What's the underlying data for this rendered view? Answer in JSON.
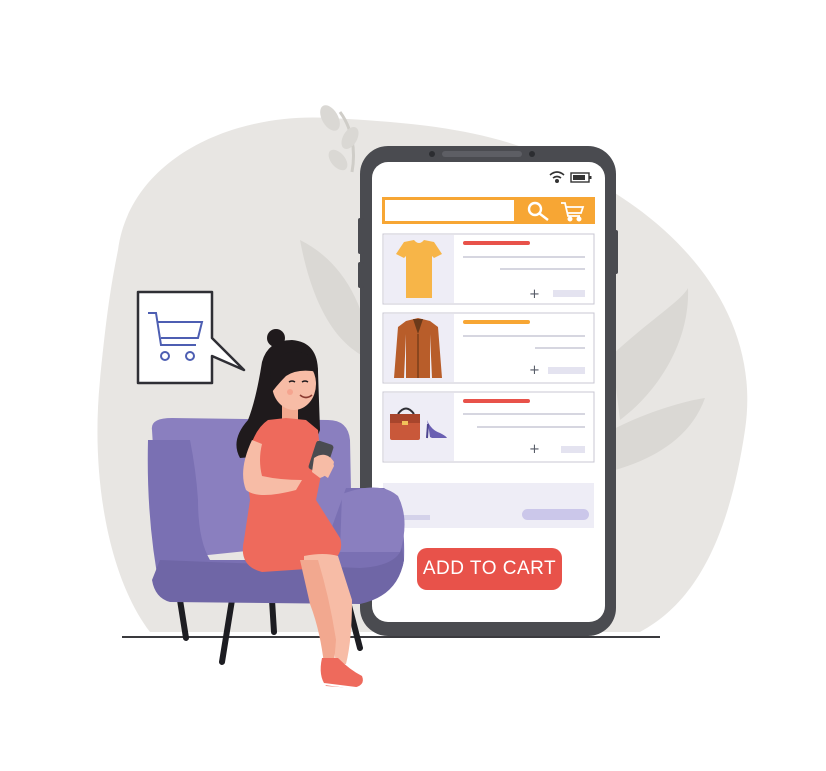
{
  "colors": {
    "blob": "#e8e6e3",
    "leaf": "#dad8d4",
    "phone_frame": "#4a4b50",
    "screen": "#ffffff",
    "accent_orange": "#f7a634",
    "accent_red": "#e8524a",
    "item_bg": "#eeedf6",
    "chair": "#8a7fbf",
    "chair_dark": "#6f66a6",
    "dress": "#ee6a5c",
    "skin": "#f7bca6",
    "hair": "#1f1a1c"
  },
  "icons": [
    "wifi-icon",
    "battery-icon",
    "search-icon",
    "cart-icon",
    "shopping-cart-speech-icon"
  ],
  "products": [
    {
      "icon": "tshirt-icon",
      "tag_color": "#e8524a",
      "plus": "+"
    },
    {
      "icon": "jacket-icon",
      "tag_color": "#f7a634",
      "plus": "+"
    },
    {
      "icon": "handbag-heels-icon",
      "tag_color": "#e8524a",
      "plus": "+"
    }
  ],
  "cta": {
    "label": "ADD TO CART"
  }
}
